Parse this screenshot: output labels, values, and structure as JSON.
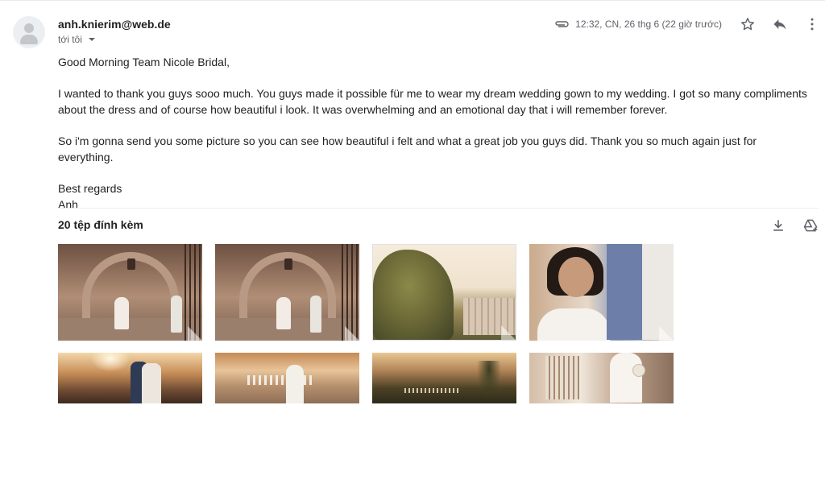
{
  "email": {
    "sender": "anh.knierim@web.de",
    "to_label": "tới tôi",
    "date": "12:32, CN, 26 thg 6 (22 giờ trước)"
  },
  "body": {
    "greeting": "Good Morning Team Nicole Bridal,",
    "paragraph1": "I wanted to thank you guys sooo much. You guys made it possible für me to wear my dream wedding gown to my wedding. I got so many compliments about the dress and of course how beautiful i look. It was overwhelming and an emotional day that i will remember forever.",
    "paragraph2": "So i'm gonna send you some picture so you can see how beautiful i felt and what a great job you guys did. Thank you so much again just for everything.",
    "closing": "Best regards",
    "signature": "Anh"
  },
  "attachments": {
    "header": "20 tệp đính kèm"
  },
  "icons": {
    "attachment": "paperclip-icon",
    "star": "star-outline-icon",
    "reply": "reply-arrow-icon",
    "more": "more-vertical-icon",
    "download": "download-icon",
    "drive": "add-to-drive-icon"
  }
}
